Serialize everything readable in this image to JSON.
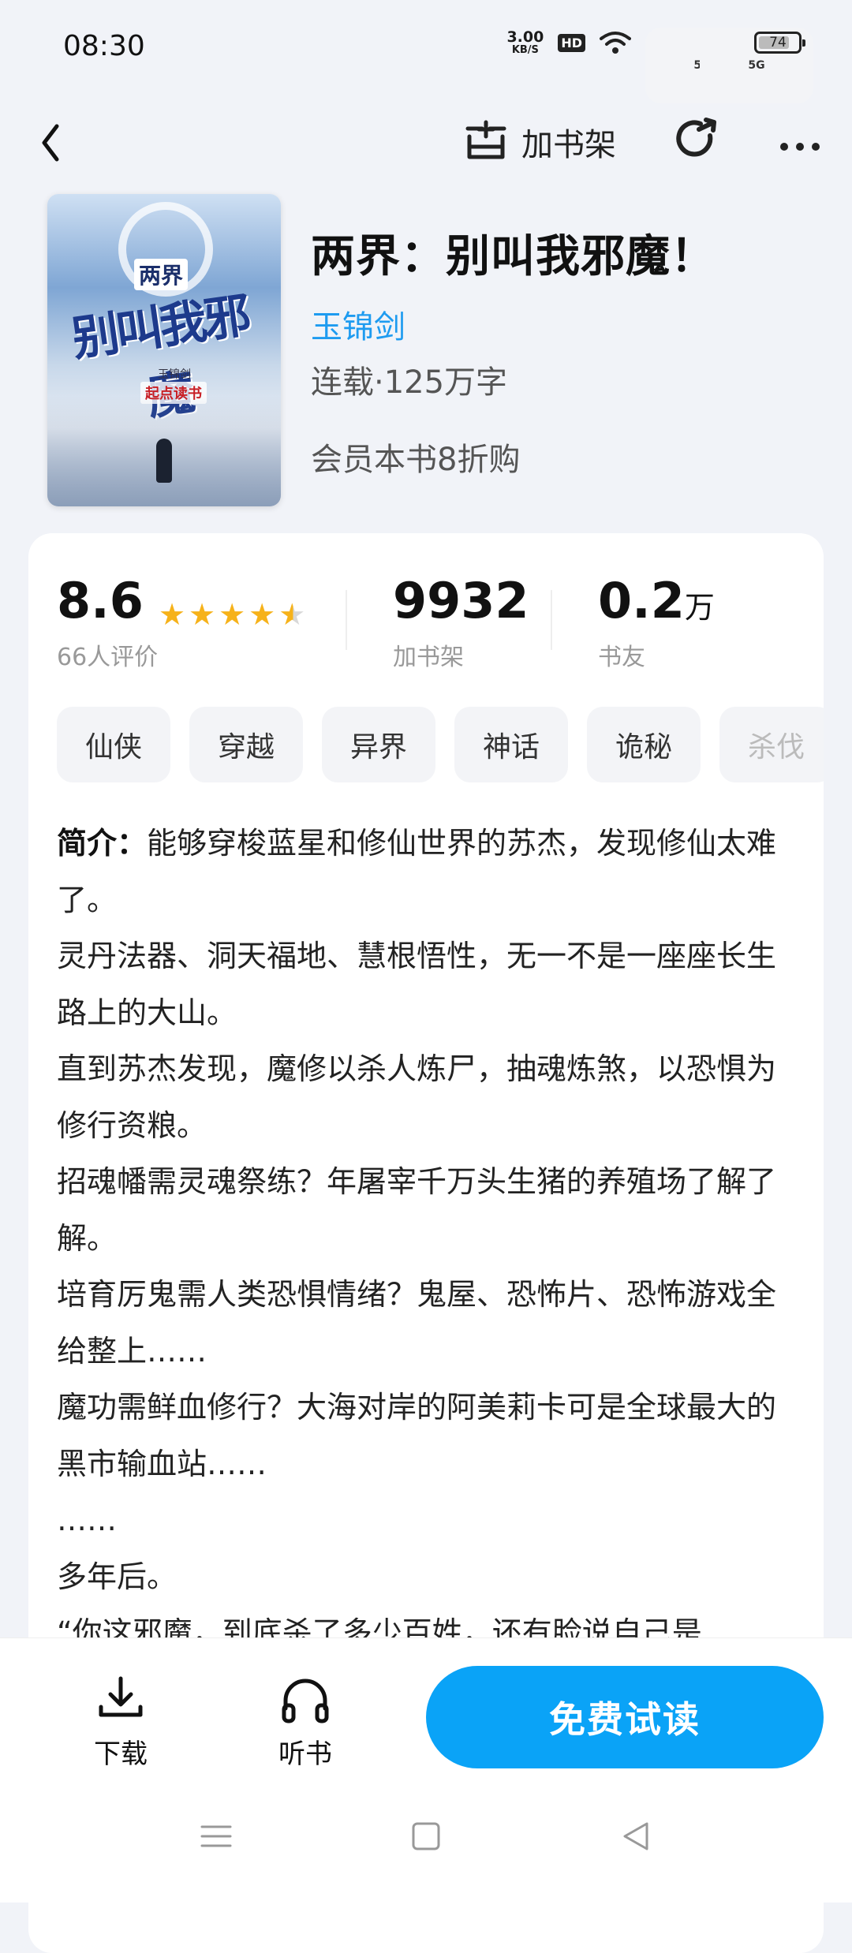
{
  "status_bar": {
    "time": "08:30",
    "net_speed_value": "3.00",
    "net_speed_unit": "KB/S",
    "hd": "HD",
    "sig1": "5G",
    "sig2": "5G",
    "battery": "74"
  },
  "nav": {
    "back_icon": "chevron-left-icon",
    "add_shelf_label": "加书架",
    "share_icon": "share-icon",
    "more_icon": "more-icon"
  },
  "book": {
    "cover": {
      "small_title": "两界",
      "title": "别叫我邪魔",
      "author": "玉锦剑",
      "publisher": "起点读书"
    },
    "title": "两界：别叫我邪魔！",
    "author": "玉锦剑",
    "meta": "连载·125万字",
    "promo": "会员本书8折购"
  },
  "stats": {
    "rating": "8.6",
    "rating_stars": 4.5,
    "rating_caption": "66人评价",
    "shelf_count": "9932",
    "shelf_caption": "加书架",
    "friends_value": "0.2",
    "friends_unit": "万",
    "friends_caption": "书友"
  },
  "tags": [
    "仙侠",
    "穿越",
    "异界",
    "神话",
    "诡秘",
    "杀伐"
  ],
  "intro": {
    "label": "简介：",
    "lines": [
      "能够穿梭蓝星和修仙世界的苏杰，发现修仙太难了。",
      "灵丹法器、洞天福地、慧根悟性，无一不是一座座长生路上的大山。",
      "直到苏杰发现，魔修以杀人炼尸，抽魂炼煞，以恐惧为修行资粮。",
      "招魂幡需灵魂祭练？年屠宰千万头生猪的养殖场了解了解。",
      "培育厉鬼需人类恐惧情绪？鬼屋、恐怖片、恐怖游戏全给整上……",
      "魔功需鲜血修行？大海对岸的阿美莉卡可是全球最大的黑市输血站……",
      "……",
      "多年后。",
      "“你这邪魔，到底杀了多少百姓，还有脸说自己是"
    ]
  },
  "bottom_bar": {
    "download_label": "下载",
    "listen_label": "听书",
    "read_label": "免费试读"
  },
  "system_nav": {
    "menu_icon": "menu-icon",
    "home_icon": "home-icon",
    "back_icon": "back-triangle-icon"
  },
  "colors": {
    "accent": "#0aa3f7",
    "author_link": "#1e9bf0",
    "star": "#f6b21a",
    "background": "#f1f3f8"
  }
}
